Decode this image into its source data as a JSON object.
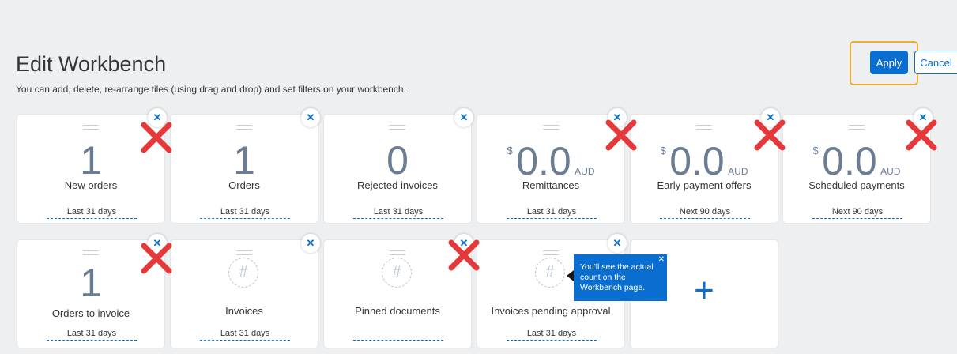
{
  "header": {
    "title": "Edit Workbench",
    "subtitle": "You can add, delete, re-arrange tiles (using drag and drop) and set filters on your workbench.",
    "apply_label": "Apply",
    "cancel_label": "Cancel"
  },
  "tiles_row1": [
    {
      "value": "1",
      "label": "New orders",
      "period": "Last 31 days"
    },
    {
      "value": "1",
      "label": "Orders",
      "period": "Last 31 days"
    },
    {
      "value": "0",
      "label": "Rejected invoices",
      "period": "Last 31 days"
    },
    {
      "currency": "$",
      "value": "0.0",
      "unit": "AUD",
      "label": "Remittances",
      "period": "Last 31 days"
    },
    {
      "currency": "$",
      "value": "0.0",
      "unit": "AUD",
      "label": "Early payment offers",
      "period": "Next 90 days"
    },
    {
      "currency": "$",
      "value": "0.0",
      "unit": "AUD",
      "label": "Scheduled payments",
      "period": "Next 90 days"
    }
  ],
  "tiles_row2": [
    {
      "value": "1",
      "label": "Orders to invoice",
      "period": "Last 31 days"
    },
    {
      "placeholder": "#",
      "label": "Invoices",
      "period": "Last 31 days"
    },
    {
      "placeholder": "#",
      "label": "Pinned documents",
      "period": ""
    },
    {
      "placeholder": "#",
      "label": "Invoices pending approval",
      "period": "Last 31 days"
    }
  ],
  "add_tile": {
    "symbol": "+"
  },
  "close_symbol": "✕",
  "tooltip": {
    "text": "You'll see the actual count on the Workbench page.",
    "close_symbol": "✕"
  },
  "colors": {
    "accent": "#0a6ed1",
    "highlight": "#f0ab32",
    "delete_mark": "#e5383b",
    "value_text": "#6a7d92"
  }
}
